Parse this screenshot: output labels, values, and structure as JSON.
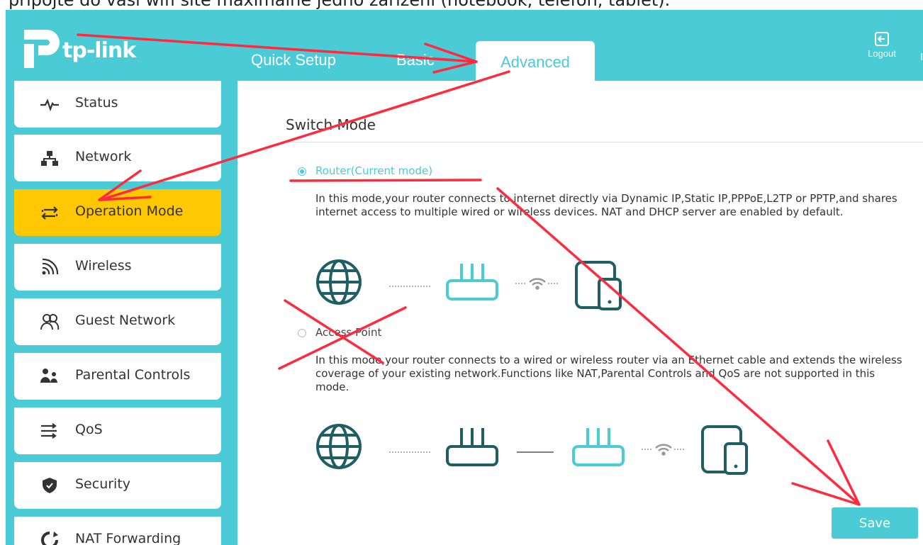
{
  "instruction_strip": "připojte do vaší wifi sítě maximálně jedno zařízení (notebook, telefon, tablet).",
  "brand": {
    "logo_text": "tp-link",
    "color": "#4acbd6"
  },
  "nav": {
    "tabs": [
      {
        "label": "Quick Setup",
        "active": false
      },
      {
        "label": "Basic",
        "active": false
      },
      {
        "label": "Advanced",
        "active": true
      }
    ],
    "logout_label": "Logout"
  },
  "sidebar": {
    "items": [
      {
        "label": "Status",
        "icon": "pulse-icon",
        "active": false
      },
      {
        "label": "Network",
        "icon": "network-icon",
        "active": false
      },
      {
        "label": "Operation Mode",
        "icon": "swap-icon",
        "active": true
      },
      {
        "label": "Wireless",
        "icon": "wireless-icon",
        "active": false
      },
      {
        "label": "Guest Network",
        "icon": "guests-icon",
        "active": false
      },
      {
        "label": "Parental Controls",
        "icon": "family-icon",
        "active": false
      },
      {
        "label": "QoS",
        "icon": "qos-icon",
        "active": false
      },
      {
        "label": "Security",
        "icon": "shield-icon",
        "active": false
      },
      {
        "label": "NAT Forwarding",
        "icon": "nat-icon",
        "active": false
      }
    ],
    "active_color": "#ffc800"
  },
  "main": {
    "title": "Switch Mode",
    "options": [
      {
        "label": "Router(Current mode)",
        "selected": true,
        "description": "In this mode,your router connects to internet directly via Dynamic IP,Static IP,PPPoE,L2TP or PPTP,and shares internet access to multiple wired or wireless devices. NAT and DHCP server are enabled by default."
      },
      {
        "label": "Access Point",
        "selected": false,
        "description": "In this mode,your router connects to a wired or wireless router via an Ethernet cable and extends the wireless coverage of your existing network.Functions like NAT,Parental Controls and QoS are not supported in this mode."
      }
    ],
    "save_label": "Save"
  },
  "annotation_color": "#ff2a3d"
}
